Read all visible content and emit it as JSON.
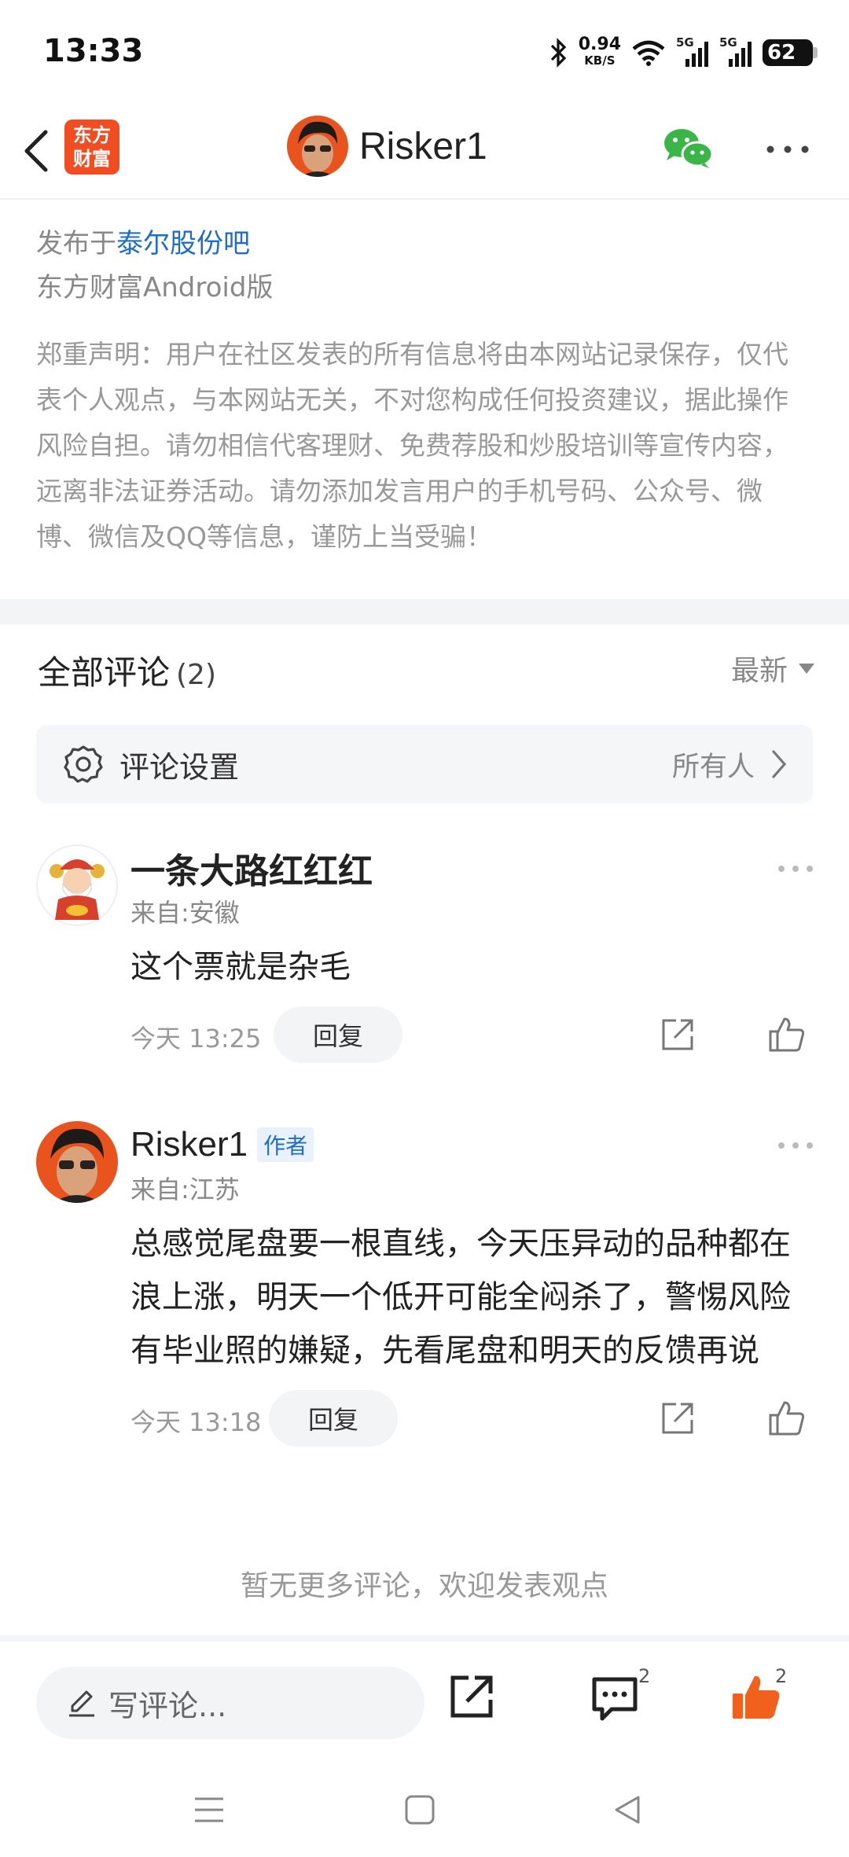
{
  "status_bar": {
    "time": "13:33",
    "net_speed": "0.94",
    "net_unit": "KB/S",
    "signal1_label": "5G",
    "signal2_label": "5G",
    "battery": "62",
    "icons": [
      "bluetooth-icon",
      "wifi-icon",
      "signal-icon",
      "battery-icon"
    ]
  },
  "nav": {
    "logo_line1": "东方",
    "logo_line2": "财富",
    "username": "Risker1",
    "colors": {
      "logo_bg": "#f04e22",
      "wechat": "#3bb548"
    }
  },
  "post": {
    "published_prefix": "发布于",
    "bar_name": "泰尔股份吧",
    "source": "东方财富Android版",
    "disclaimer": "郑重声明：用户在社区发表的所有信息将由本网站记录保存，仅代表个人观点，与本网站无关，不对您构成任何投资建议，据此操作风险自担。请勿相信代客理财、免费荐股和炒股培训等宣传内容，远离非法证券活动。请勿添加发言用户的手机号码、公众号、微博、微信及QQ等信息，谨防上当受骗！"
  },
  "comments_header": {
    "title": "全部评论",
    "count": "(2)",
    "sort": "最新"
  },
  "comment_settings": {
    "label": "评论设置",
    "value": "所有人"
  },
  "comments": [
    {
      "name": "一条大路红红红",
      "location": "来自:安徽",
      "text": "这个票就是杂毛",
      "time": "今天 13:25",
      "reply": "回复"
    },
    {
      "name": "Risker1",
      "tag": "作者",
      "location": "来自:江苏",
      "text": "总感觉尾盘要一根直线，今天压异动的品种都在浪上涨，明天一个低开可能全闷杀了，警惕风险有毕业照的嫌疑，先看尾盘和明天的反馈再说",
      "time": "今天 13:18",
      "reply": "回复"
    }
  ],
  "no_more": "暂无更多评论，欢迎发表观点",
  "bottom_bar": {
    "input_placeholder": "写评论...",
    "comment_count": "2",
    "like_count": "2",
    "colors": {
      "like": "#f0611e"
    }
  }
}
